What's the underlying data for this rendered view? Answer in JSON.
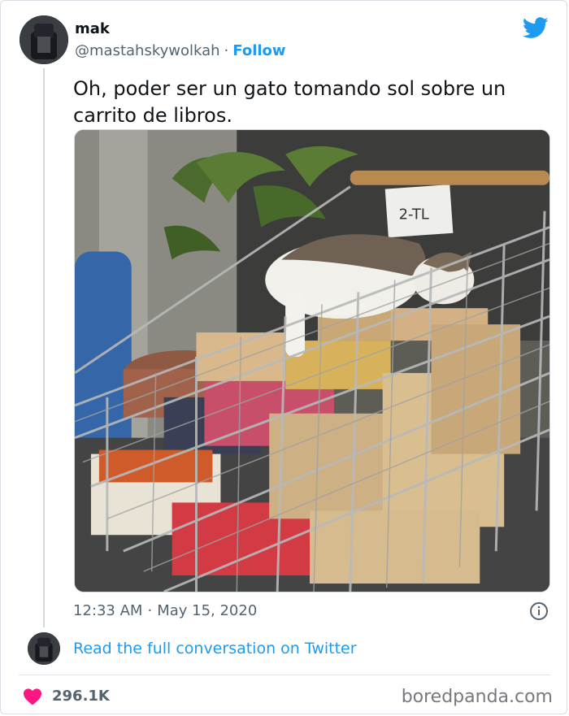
{
  "author": {
    "name": "mak",
    "handle": "@mastahskywolkah",
    "separator": "·",
    "follow_label": "Follow",
    "avatar_icon": "avatar-image"
  },
  "brand_icon": "twitter-bird-icon",
  "tweet": {
    "text": "Oh, poder ser un gato tomando sol sobre un carrito de libros.",
    "image_description_icon": "photo-cat-on-book-cart",
    "time": "12:33 AM",
    "separator": "·",
    "date": "May 15, 2020"
  },
  "conversation": {
    "read_link": "Read the full conversation on Twitter"
  },
  "engagement": {
    "likes": "296.1K",
    "heart_color": "#f91880"
  },
  "watermark": "boredpanda.com",
  "colors": {
    "link_blue": "#1d9bf0",
    "muted_gray": "#536471",
    "text": "#0f1419"
  }
}
